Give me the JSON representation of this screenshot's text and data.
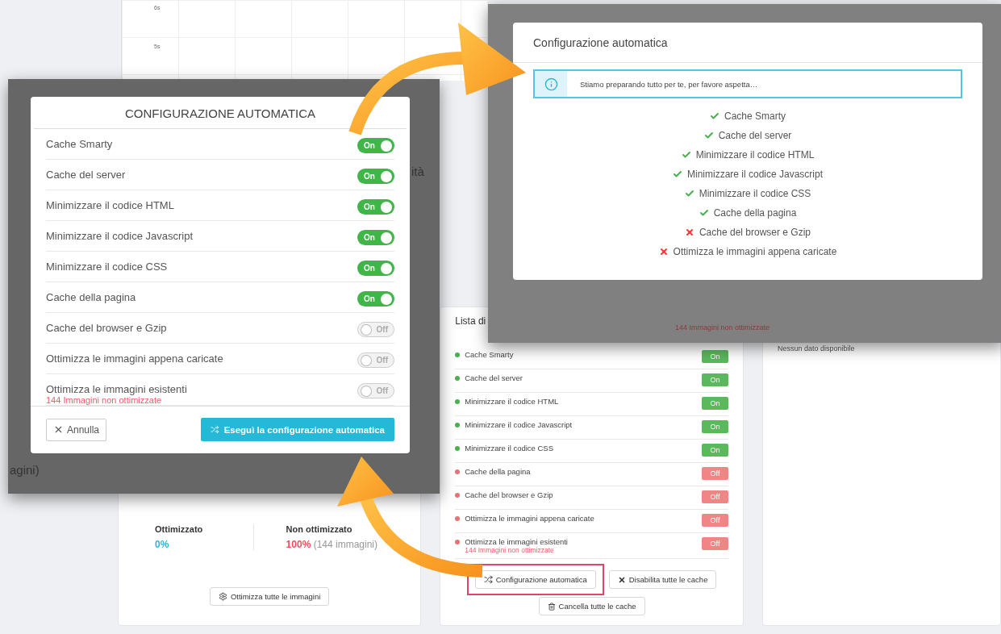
{
  "page": {
    "chart_ticks": [
      "6s",
      "5s"
    ],
    "stats_card": {
      "stats": [
        {
          "label": "Ottimizzato",
          "value": "0%",
          "kind": "good"
        },
        {
          "label": "Non ottimizzato",
          "value": "100%",
          "detail": "(144 immagini)",
          "kind": "bad"
        }
      ],
      "button": "Ottimizza tutte le immagini"
    },
    "status_card": {
      "title": "Lista di",
      "items": [
        {
          "label": "Cache Smarty",
          "on": true,
          "badge": "On"
        },
        {
          "label": "Cache del server",
          "on": true,
          "badge": "On"
        },
        {
          "label": "Minimizzare il codice HTML",
          "on": true,
          "badge": "On"
        },
        {
          "label": "Minimizzare il codice Javascript",
          "on": true,
          "badge": "On"
        },
        {
          "label": "Minimizzare il codice CSS",
          "on": true,
          "badge": "On"
        },
        {
          "label": "Cache della pagina",
          "on": false,
          "badge": "Off"
        },
        {
          "label": "Cache del browser e Gzip",
          "on": false,
          "badge": "Off"
        },
        {
          "label": "Ottimizza le immagini appena caricate",
          "on": false,
          "badge": "Off"
        },
        {
          "label": "Ottimizza le immagini esistenti",
          "on": false,
          "badge": "Off",
          "note": "144 Immagini non ottimizzate"
        }
      ],
      "buttons": [
        {
          "label": "Configurazione automatica",
          "kind": "auto",
          "highlighted": true
        },
        {
          "label": "Disabilita tutte le cache",
          "kind": "disable",
          "highlighted": false
        },
        {
          "label": "Cancella tutte le cache",
          "kind": "delete",
          "highlighted": false
        }
      ]
    },
    "empty_card": {
      "text": "Nessun dato disponibile"
    }
  },
  "left_window": {
    "backdrop_texts": [
      "ità",
      "agini)"
    ],
    "title": "CONFIGURAZIONE AUTOMATICA",
    "options": [
      {
        "label": "Cache Smarty",
        "on": true,
        "toggle": "On"
      },
      {
        "label": "Cache del server",
        "on": true,
        "toggle": "On"
      },
      {
        "label": "Minimizzare il codice HTML",
        "on": true,
        "toggle": "On"
      },
      {
        "label": "Minimizzare il codice Javascript",
        "on": true,
        "toggle": "On"
      },
      {
        "label": "Minimizzare il codice CSS",
        "on": true,
        "toggle": "On"
      },
      {
        "label": "Cache della pagina",
        "on": true,
        "toggle": "On"
      },
      {
        "label": "Cache del browser e Gzip",
        "on": false,
        "toggle": "Off"
      },
      {
        "label": "Ottimizza le immagini appena caricate",
        "on": false,
        "toggle": "Off"
      },
      {
        "label": "Ottimizza le immagini esistenti",
        "on": false,
        "toggle": "Off",
        "note": "144 Immagini non ottimizzate"
      }
    ],
    "cancel": "Annulla",
    "run": "Eseguì la configurazione automatica"
  },
  "right_window": {
    "backdrop_texts": [
      "144 Immagini non ottimizzate"
    ],
    "title": "Configurazione automatica",
    "alert": "Stiamo preparando tutto per te, per favore aspetta…",
    "steps": [
      {
        "label": "Cache Smarty",
        "done": true
      },
      {
        "label": "Cache del server",
        "done": true
      },
      {
        "label": "Minimizzare il codice HTML",
        "done": true
      },
      {
        "label": "Minimizzare il codice Javascript",
        "done": true
      },
      {
        "label": "Minimizzare il codice CSS",
        "done": true
      },
      {
        "label": "Cache della pagina",
        "done": true
      },
      {
        "label": "Cache del browser e Gzip",
        "done": false
      },
      {
        "label": "Ottimizza le immagini appena caricate",
        "done": false
      }
    ]
  }
}
